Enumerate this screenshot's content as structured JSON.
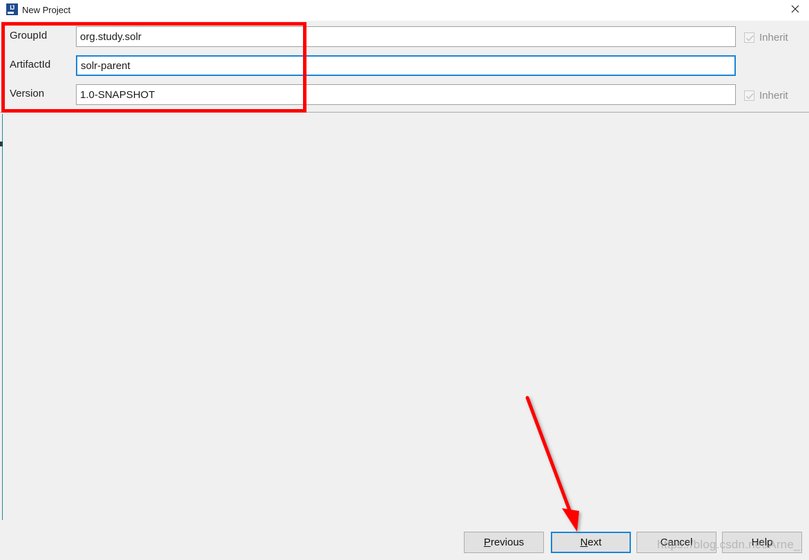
{
  "window": {
    "title": "New Project",
    "icon": "intellij-idea-icon",
    "close_icon": "close-icon",
    "titlebar_color": "#ffffff",
    "background_color": "#f0f0f0"
  },
  "form": {
    "fields": [
      {
        "label": "GroupId",
        "value": "org.study.solr",
        "placeholder": "",
        "focused": false,
        "inherit": {
          "label": "Inherit",
          "checked": true,
          "enabled": false
        }
      },
      {
        "label": "ArtifactId",
        "value": "solr-parent",
        "placeholder": "",
        "focused": true,
        "inherit": null
      },
      {
        "label": "Version",
        "value": "1.0-SNAPSHOT",
        "placeholder": "",
        "focused": false,
        "inherit": {
          "label": "Inherit",
          "checked": true,
          "enabled": false
        }
      }
    ]
  },
  "buttons": {
    "previous": {
      "prefix": "",
      "mnemonic": "P",
      "suffix": "revious",
      "default": false
    },
    "next": {
      "prefix": "",
      "mnemonic": "N",
      "suffix": "ext",
      "default": true
    },
    "cancel": {
      "prefix": "",
      "mnemonic": "",
      "suffix": "Cancel",
      "default": false
    },
    "help": {
      "prefix": "",
      "mnemonic": "",
      "suffix": "Help",
      "default": false
    }
  },
  "annotations": {
    "highlight_box_color": "#ff0000",
    "arrow_color": "#ff0000",
    "arrow_from": "(763, 575)",
    "arrow_to": "(836, 772)"
  },
  "watermark": {
    "text": "https://blog.csdn.net/Arne_",
    "color": "#969696"
  },
  "accent": {
    "focus_color": "#1a85d6",
    "rail_color": "#1f8a9c"
  }
}
